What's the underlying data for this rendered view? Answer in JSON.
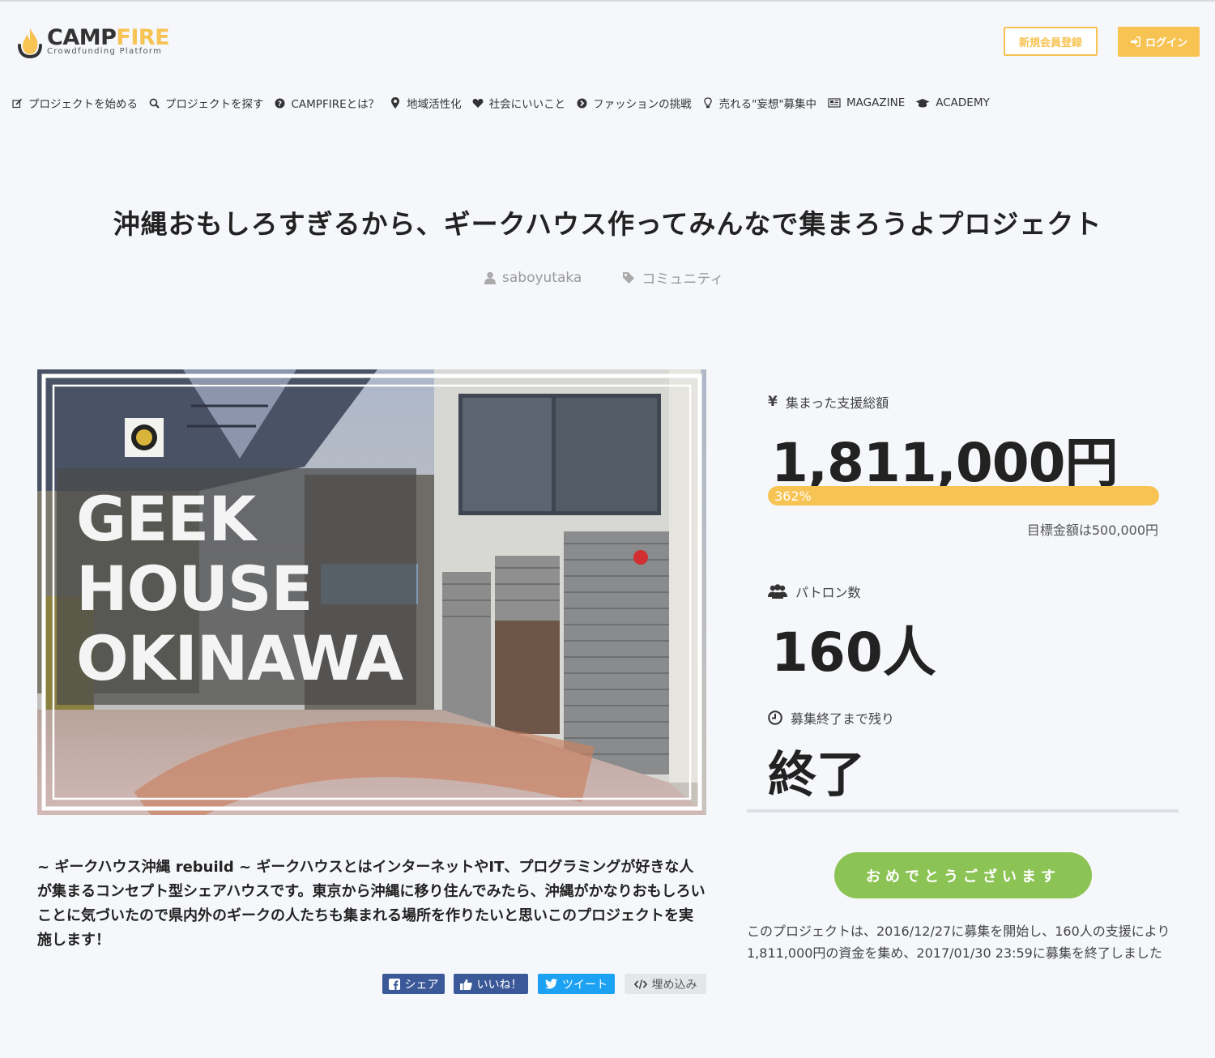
{
  "header": {
    "logo_main_a": "CAMP",
    "logo_main_b": "FIRE",
    "logo_sub": "Crowdfunding Platform",
    "register_label": "新規会員登録",
    "login_label": "ログイン"
  },
  "nav": {
    "items": [
      {
        "icon": "edit-icon",
        "label": "プロジェクトを始める"
      },
      {
        "icon": "search-icon",
        "label": "プロジェクトを探す"
      },
      {
        "icon": "question-icon",
        "label": "CAMPFIREとは？"
      },
      {
        "icon": "map-pin-icon",
        "label": "地域活性化"
      },
      {
        "icon": "heart-icon",
        "label": "社会にいいこと"
      },
      {
        "icon": "arrow-circle-icon",
        "label": "ファッションの挑戦"
      },
      {
        "icon": "lightbulb-icon",
        "label": "売れる\"妄想\"募集中"
      },
      {
        "icon": "newspaper-icon",
        "label": "MAGAZINE"
      },
      {
        "icon": "graduation-cap-icon",
        "label": "ACADEMY"
      }
    ]
  },
  "project": {
    "title": "沖縄おもしろすぎるから、ギークハウス作ってみんなで集まろうよプロジェクト",
    "owner": "saboyutaka",
    "category": "コミュニティ",
    "hero_text": [
      "GEEK",
      "HOUSE",
      "OKINAWA"
    ],
    "description": "~ ギークハウス沖縄 rebuild ~ ギークハウスとはインターネットやIT、プログラミングが好きな人が集まるコンセプト型シェアハウスです。東京から沖縄に移り住んでみたら、沖縄がかなりおもしろいことに気づいたので県内外のギークの人たちも集まれる場所を作りたいと思いこのプロジェクトを実施します！"
  },
  "stats": {
    "amount_label": "集まった支援総額",
    "amount": "1,811,000円",
    "progress_percent": 362,
    "progress_text": "362%",
    "goal": "目標金額は500,000円",
    "patrons_label": "パトロン数",
    "patrons": "160人",
    "remaining_label": "募集終了まで残り",
    "remaining": "終了"
  },
  "cta": {
    "congrats": "おめでとうございます",
    "summary": "このプロジェクトは、2016/12/27に募集を開始し、160人の支援により1,811,000円の資金を集め、2017/01/30 23:59に募集を終了しました"
  },
  "share": {
    "facebook": "シェア",
    "like": "いいね！",
    "tweet": "ツイート",
    "embed": "埋め込み"
  },
  "colors": {
    "brand_yellow": "#f7c353",
    "success_green": "#8cc355",
    "facebook_blue": "#3b5998",
    "twitter_blue": "#1da1f2"
  }
}
